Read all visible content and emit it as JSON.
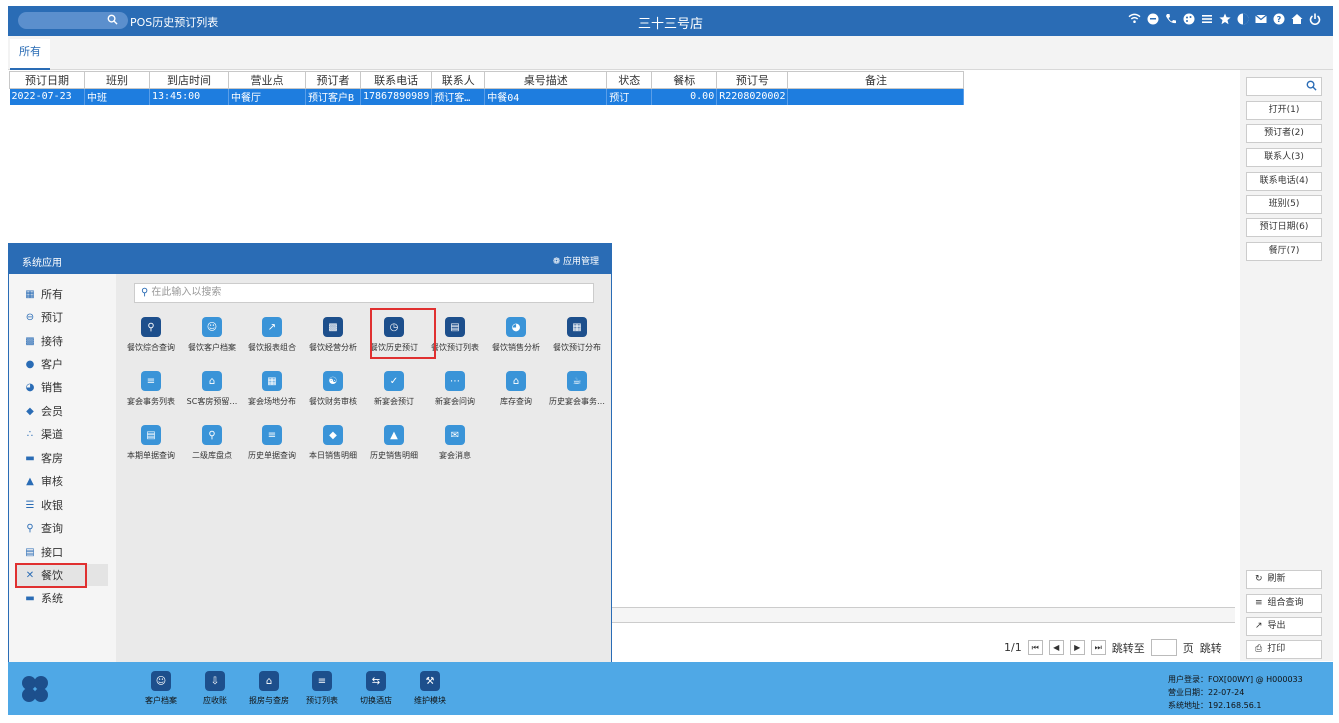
{
  "topbar": {
    "title": "POS历史预订列表",
    "store": "三十三号店",
    "icons": [
      "wifi-icon",
      "message-icon",
      "phone-icon",
      "palette-icon",
      "menu-icon",
      "star-icon",
      "contrast-icon",
      "mail-icon",
      "help-icon",
      "home-icon",
      "power-icon"
    ]
  },
  "tabs": [
    {
      "label": "所有"
    }
  ],
  "grid": {
    "columns": [
      "预订日期",
      "班别",
      "到店时间",
      "营业点",
      "预订者",
      "联系电话",
      "联系人",
      "桌号描述",
      "状态",
      "餐标",
      "预订号",
      "备注"
    ],
    "rows": [
      [
        "2022-07-23",
        "中班",
        "13:45:00",
        "中餐厅",
        "预订客户B",
        "17867890989",
        "预订客…",
        "中餐04",
        "预订",
        "0.00",
        "R2208020002",
        ""
      ]
    ]
  },
  "pager": {
    "page": "1/1",
    "jump_label": "跳转至",
    "page_unit": "页",
    "jump_button": "跳转"
  },
  "right_panel": {
    "buttons": [
      "打开(1)",
      "预订者(2)",
      "联系人(3)",
      "联系电话(4)",
      "班别(5)",
      "预订日期(6)",
      "餐厅(7)"
    ],
    "bottom_buttons": [
      {
        "label": "刷新",
        "icon": "refresh-icon"
      },
      {
        "label": "组合查询",
        "icon": "list-icon"
      },
      {
        "label": "导出",
        "icon": "export-icon"
      },
      {
        "label": "打印",
        "icon": "print-icon"
      }
    ]
  },
  "popup": {
    "title": "系统应用",
    "manage_label": "应用管理",
    "search_placeholder": "在此输入以搜索",
    "categories": [
      "所有",
      "预订",
      "接待",
      "客户",
      "销售",
      "会员",
      "渠道",
      "客房",
      "审核",
      "收银",
      "查询",
      "接口",
      "餐饮",
      "系统"
    ],
    "active_category": "餐饮",
    "apps": [
      [
        "餐饮综合查询",
        "餐饮客户档案",
        "餐饮报表组合",
        "餐饮经营分析",
        "餐饮历史预订",
        "餐饮预订列表",
        "餐饮销售分析",
        "餐饮预订分布"
      ],
      [
        "宴会事务列表",
        "SC客房预留…",
        "宴会场地分布",
        "餐饮财务审核",
        "新宴会预订",
        "新宴会问询",
        "库存查询",
        "历史宴会事务…"
      ],
      [
        "本期单据查询",
        "二级库盘点",
        "历史单据查询",
        "本日销售明细",
        "历史销售明细",
        "宴会消息"
      ]
    ],
    "highlighted_app": "餐饮历史预订"
  },
  "dock": {
    "apps": [
      "客户档案",
      "应收账",
      "报房与查房",
      "预订列表",
      "切换酒店",
      "维护模块"
    ],
    "info": {
      "user": "用户登录：FOX[00WY] @ H000033",
      "business_date": "营业日期：22-07-24",
      "address": "系统地址：192.168.56.1"
    }
  },
  "colors": {
    "primary": "#2a6cb5",
    "row_selected": "#1e7ddf",
    "dock": "#4fa8e6",
    "highlight_border": "#e03030"
  }
}
